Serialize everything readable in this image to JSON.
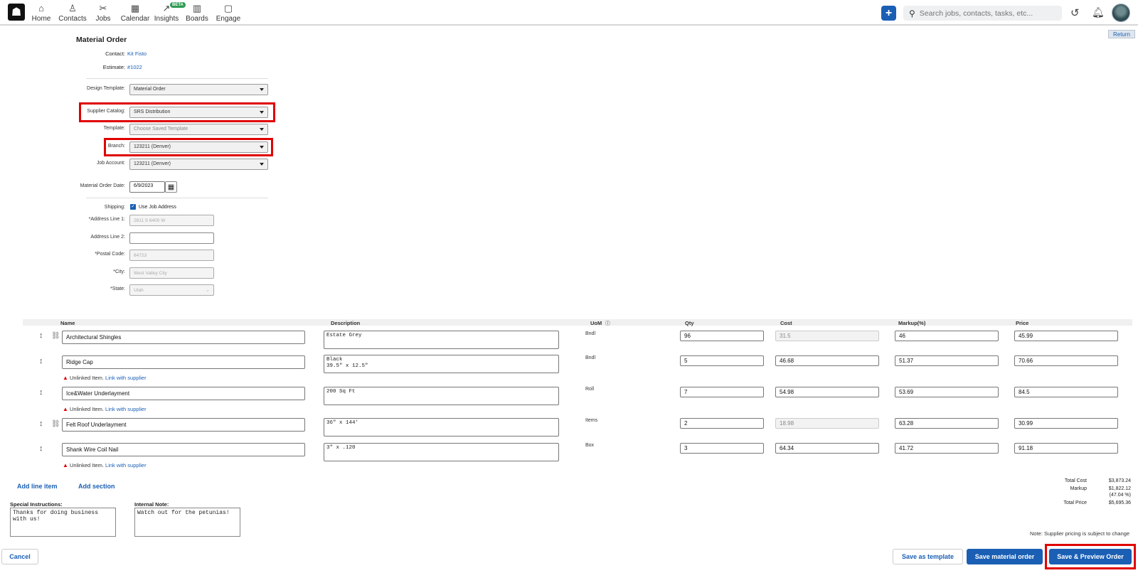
{
  "nav": {
    "items": [
      {
        "label": "Home",
        "icon": "home-icon"
      },
      {
        "label": "Contacts",
        "icon": "person-icon"
      },
      {
        "label": "Jobs",
        "icon": "tools-icon"
      },
      {
        "label": "Calendar",
        "icon": "calendar-icon"
      },
      {
        "label": "Insights",
        "icon": "chart-icon",
        "badge": "BETA"
      },
      {
        "label": "Boards",
        "icon": "board-icon"
      },
      {
        "label": "Engage",
        "icon": "chat-icon"
      }
    ],
    "search_placeholder": "Search jobs, contacts, tasks, etc...",
    "return_label": "Return"
  },
  "form": {
    "title": "Material Order",
    "contact_label": "Contact:",
    "contact_value": "Kit Fisto",
    "estimate_label": "Estimate:",
    "estimate_value": "#1022",
    "design_template_label": "Design Template:",
    "design_template_value": "Material Order",
    "supplier_catalog_label": "Supplier Catalog:",
    "supplier_catalog_value": "SRS Distribution",
    "template_label": "Template:",
    "template_value": "Choose Saved Template",
    "branch_label": "Branch:",
    "branch_value": "123211 (Denver)",
    "job_account_label": "Job Account:",
    "job_account_value": "123211 (Denver)",
    "order_date_label": "Material Order Date:",
    "order_date_value": "6/9/2023",
    "shipping_label": "Shipping:",
    "use_job_address_label": "Use Job Address",
    "address1_label": "*Address Line 1:",
    "address1_value": "2811 S 6400 W",
    "address2_label": "Address Line 2:",
    "address2_value": "",
    "postal_label": "*Postal Code:",
    "postal_value": "84723",
    "city_label": "*City:",
    "city_value": "West Valley City",
    "state_label": "*State:",
    "state_value": "Utah"
  },
  "table": {
    "headers": {
      "name": "Name",
      "description": "Description",
      "uom": "UoM",
      "qty": "Qty",
      "cost": "Cost",
      "markup": "Markup(%)",
      "price": "Price"
    },
    "rows": [
      {
        "name": "Architectural Shingles",
        "description": "Estate Grey",
        "uom": "Bndl",
        "qty": "96",
        "cost": "31.5",
        "markup": "46",
        "price": "45.99",
        "linked": true
      },
      {
        "name": "Ridge Cap",
        "description": "Black\n39.5\" x 12.5\"",
        "uom": "Bndl",
        "qty": "5",
        "cost": "46.68",
        "markup": "51.37",
        "price": "70.66",
        "linked": false
      },
      {
        "name": "Ice&Water Underlayment",
        "description": "200 Sq Ft",
        "uom": "Roll",
        "qty": "7",
        "cost": "54.98",
        "markup": "53.69",
        "price": "84.5",
        "linked": false
      },
      {
        "name": "Felt Roof Underlayment",
        "description": "36\" x 144'",
        "uom": "Items",
        "qty": "2",
        "cost": "18.98",
        "markup": "63.28",
        "price": "30.99",
        "linked": true
      },
      {
        "name": "Shank Wire Coil Nail",
        "description": "3\" x .120",
        "uom": "Box",
        "qty": "3",
        "cost": "64.34",
        "markup": "41.72",
        "price": "91.18",
        "linked": false
      }
    ],
    "unlinked_text": "Unlinked Item.",
    "link_supplier_text": "Link with supplier"
  },
  "actions": {
    "add_line_item": "Add line item",
    "add_section": "Add section"
  },
  "notes": {
    "special_label": "Special Instructions:",
    "special_value": "Thanks for doing business\nwith us!",
    "internal_label": "Internal Note:",
    "internal_value": "Watch out for the petunias!"
  },
  "totals": {
    "total_cost_label": "Total Cost",
    "total_cost": "$3,873.24",
    "markup_label": "Markup",
    "markup": "$1,822.12",
    "markup_pct": "(47.04 %)",
    "total_price_label": "Total Price",
    "total_price": "$5,695.36"
  },
  "supplier_note": "Note: Supplier pricing is subject to change",
  "buttons": {
    "cancel": "Cancel",
    "save_template": "Save as template",
    "save_material": "Save material order",
    "save_preview": "Save & Preview Order"
  },
  "colors": {
    "accent": "#1a5fb4",
    "highlight": "#e00000",
    "warning": "#dd0000"
  }
}
